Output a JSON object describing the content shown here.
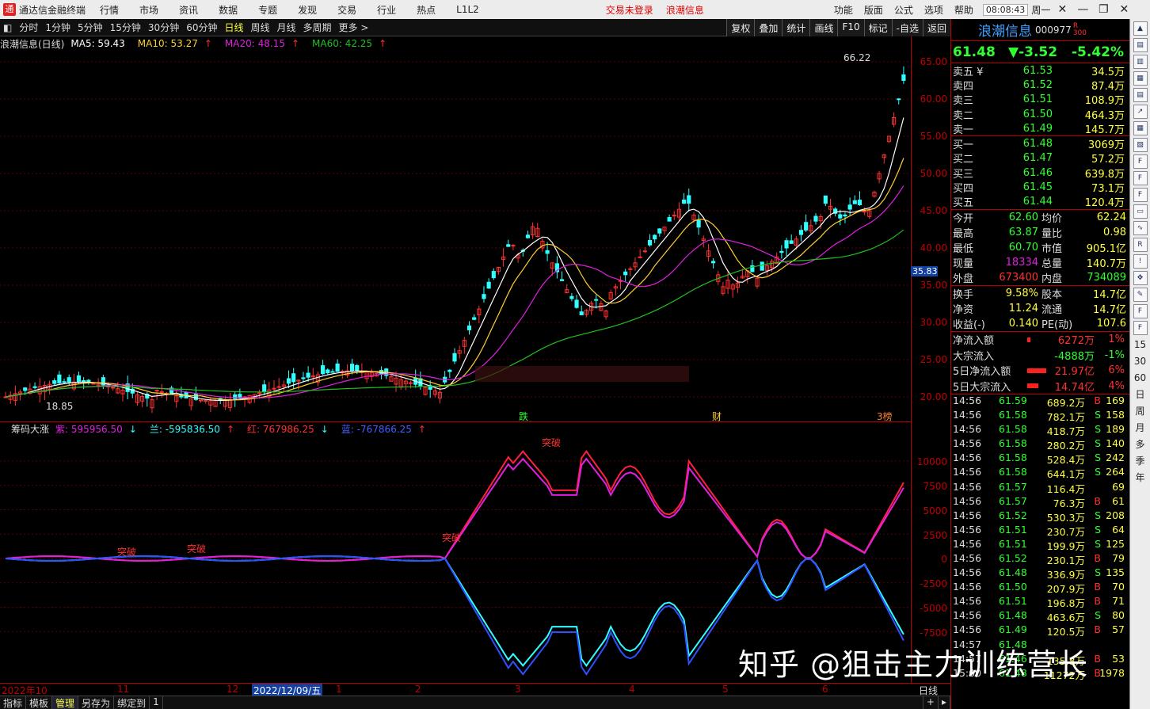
{
  "titlebar": {
    "app": "通达信金融终端",
    "menus": [
      "行情",
      "市场",
      "资讯",
      "数据",
      "专题",
      "发现",
      "交易",
      "行业",
      "热点",
      "L1L2"
    ],
    "notice1": "交易未登录",
    "notice2": "浪潮信息",
    "rmenus": [
      "功能",
      "版面",
      "公式",
      "选项",
      "帮助"
    ],
    "time": "08:08:43",
    "weekday": "周一"
  },
  "toolbar": {
    "periods": [
      "分时",
      "1分钟",
      "5分钟",
      "15分钟",
      "30分钟",
      "60分钟",
      "日线",
      "周线",
      "月线",
      "多周期",
      "更多 >"
    ],
    "active": "日线",
    "right": [
      "复权",
      "叠加",
      "统计",
      "画线",
      "F10",
      "标记",
      "-自选",
      "返回"
    ]
  },
  "info": {
    "name": "浪潮信息(日线)",
    "ma5": "MA5: 59.43",
    "ma10": "MA10: 53.27",
    "ma20": "MA20: 48.15",
    "ma60": "MA60: 42.25",
    "arrow": "↑"
  },
  "yaxis": [
    "65.00",
    "60.00",
    "55.00",
    "50.00",
    "45.00",
    "40.00",
    "35.00",
    "30.00",
    "25.00",
    "20.00"
  ],
  "current_price_box": "35.83",
  "kline_annotations": {
    "high": "66.22",
    "low": "18.85",
    "marks": [
      "跌",
      "财",
      "3榜"
    ]
  },
  "indicator": {
    "name": "筹码大涨",
    "purple": "紫: 595956.50",
    "purple_arrow": "↓",
    "cyan": "兰: -595836.50",
    "cyan_arrow": "↑",
    "red": "红: 767986.25",
    "red_arrow": "↓",
    "blue": "蓝: -767866.25",
    "blue_arrow": "↑",
    "labels": [
      "突破",
      "突破",
      "突破",
      "突破"
    ]
  },
  "yaxis2": [
    "10000",
    "7500",
    "5000",
    "2500",
    "0",
    "-2500",
    "-5000",
    "-7500"
  ],
  "dates": [
    "2022年10",
    "11",
    "12",
    "2022/12/09/五",
    "1",
    "2",
    "3",
    "4",
    "5",
    "6"
  ],
  "bottom": [
    "指标",
    "模板",
    "管理",
    "另存为",
    "绑定到",
    "1"
  ],
  "bottom_active": "管理",
  "side": {
    "name": "浪潮信息",
    "code": "000977",
    "tag": "R",
    "sub": "300",
    "price": "61.48",
    "change": "▼-3.52",
    "pct": "-5.42%",
    "asks": [
      [
        "卖五 ¥",
        "61.53",
        "34.5万"
      ],
      [
        "卖四",
        "61.52",
        "87.4万"
      ],
      [
        "卖三",
        "61.51",
        "108.9万"
      ],
      [
        "卖二",
        "61.50",
        "464.3万"
      ],
      [
        "卖一",
        "61.49",
        "145.7万"
      ]
    ],
    "bids": [
      [
        "买一",
        "61.48",
        "3069万"
      ],
      [
        "买二",
        "61.47",
        "57.2万"
      ],
      [
        "买三",
        "61.46",
        "639.8万"
      ],
      [
        "买四",
        "61.45",
        "73.1万"
      ],
      [
        "买五",
        "61.44",
        "120.4万"
      ]
    ],
    "stats": [
      [
        "今开",
        "62.60",
        "均价",
        "62.24"
      ],
      [
        "最高",
        "63.87",
        "量比",
        "0.98"
      ],
      [
        "最低",
        "60.70",
        "市值",
        "905.1亿"
      ],
      [
        "现量",
        "18334",
        "总量",
        "140.7万"
      ],
      [
        "外盘",
        "673400",
        "内盘",
        "734089"
      ]
    ],
    "stats2": [
      [
        "换手",
        "9.58%",
        "股本",
        "14.7亿"
      ],
      [
        "净资",
        "11.24",
        "流通",
        "14.7亿"
      ],
      [
        "收益(-)",
        "0.140",
        "PE(动)",
        "107.6"
      ]
    ],
    "flows": [
      [
        "净流入额",
        "6272万",
        "1%"
      ],
      [
        "大宗流入",
        "-4888万",
        "-1%"
      ],
      [
        "5日净流入额",
        "21.97亿",
        "6%"
      ],
      [
        "5日大宗流入",
        "14.74亿",
        "4%"
      ]
    ],
    "ticks": [
      [
        "14:56",
        "61.59",
        "689.2万",
        "B",
        "169"
      ],
      [
        "14:56",
        "61.58",
        "782.1万",
        "S",
        "158"
      ],
      [
        "14:56",
        "61.58",
        "418.7万",
        "S",
        "189"
      ],
      [
        "14:56",
        "61.58",
        "280.2万",
        "S",
        "140"
      ],
      [
        "14:56",
        "61.58",
        "528.4万",
        "S",
        "242"
      ],
      [
        "14:56",
        "61.58",
        "644.1万",
        "S",
        "264"
      ],
      [
        "14:56",
        "61.57",
        "116.4万",
        "",
        "69"
      ],
      [
        "14:56",
        "61.57",
        "76.3万",
        "B",
        "61"
      ],
      [
        "14:56",
        "61.52",
        "530.3万",
        "S",
        "208"
      ],
      [
        "14:56",
        "61.51",
        "230.7万",
        "S",
        "64"
      ],
      [
        "14:56",
        "61.51",
        "199.9万",
        "S",
        "125"
      ],
      [
        "14:56",
        "61.52",
        "230.1万",
        "B",
        "79"
      ],
      [
        "14:56",
        "61.48",
        "336.9万",
        "S",
        "135"
      ],
      [
        "14:56",
        "61.50",
        "207.9万",
        "B",
        "70"
      ],
      [
        "14:56",
        "61.51",
        "196.8万",
        "B",
        "71"
      ],
      [
        "14:56",
        "61.48",
        "463.6万",
        "S",
        "80"
      ],
      [
        "14:56",
        "61.49",
        "120.5万",
        "B",
        "57"
      ],
      [
        "14:57",
        "61.48",
        "",
        "",
        ""
      ],
      [
        "14:57",
        "61.46",
        "135.8万",
        "B",
        "53"
      ],
      [
        "15:00",
        "61.48",
        "11272万",
        "B",
        "1978"
      ]
    ]
  },
  "rside_labels": [
    "15",
    "30",
    "60",
    "日",
    "周",
    "月",
    "多",
    "季",
    "年"
  ],
  "watermark": "知乎 @狙击主力训练营长",
  "colors": {
    "up": "#ff3030",
    "down": "#30ffff",
    "ma5": "#ffffff",
    "ma10": "#ffd030",
    "ma20": "#e020e0",
    "ma60": "#20c020"
  },
  "datebar_right": "日线"
}
